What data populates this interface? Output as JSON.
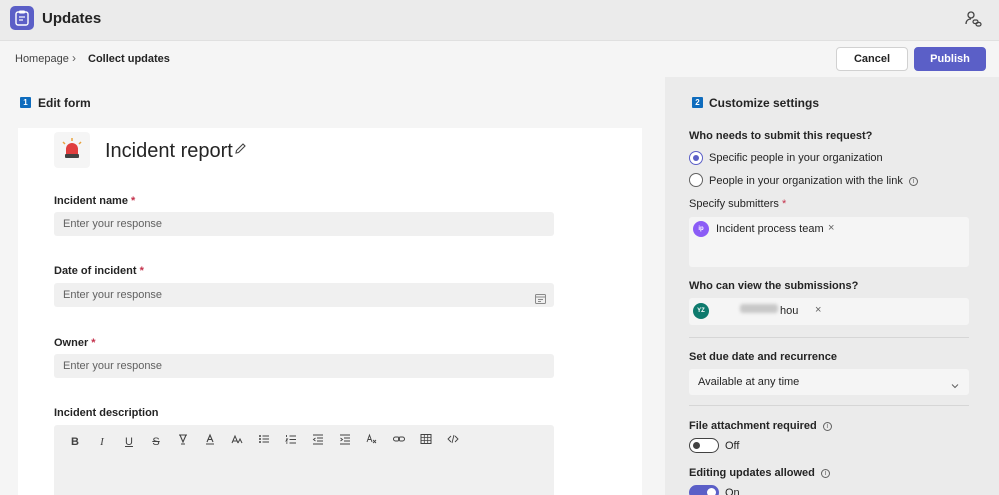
{
  "app": {
    "title": "Updates"
  },
  "breadcrumb": {
    "home": "Homepage",
    "separator": "›",
    "current": "Collect updates"
  },
  "actions": {
    "cancel_label": "Cancel",
    "publish_label": "Publish"
  },
  "edit_form": {
    "step": "1",
    "title": "Edit form",
    "form_title": "Incident report",
    "fields": [
      {
        "label": "Incident name",
        "required_mark": "*",
        "placeholder": "Enter your response"
      },
      {
        "label": "Date of incident",
        "required_mark": "*",
        "placeholder": "Enter your response"
      },
      {
        "label": "Owner",
        "required_mark": "*",
        "placeholder": "Enter your response"
      }
    ],
    "description_label": "Incident description",
    "toolbar": [
      "B",
      "I",
      "U",
      "S"
    ]
  },
  "settings": {
    "step": "2",
    "title": "Customize settings",
    "submit_question": "Who needs to submit this request?",
    "options": [
      {
        "label": "Specific people in your organization",
        "selected": true
      },
      {
        "label": "People in your organization with the link",
        "selected": false
      }
    ],
    "submitters_label": "Specify submitters",
    "submitters_required": "*",
    "submitter_chip": {
      "initials": "ip",
      "name": "Incident process team",
      "remove": "×"
    },
    "view_question": "Who can view the submissions?",
    "viewer_chip": {
      "initials": "YZ",
      "name_visible": "hou",
      "remove": "×"
    },
    "due_date_label": "Set due date and recurrence",
    "due_date_value": "Available at any time",
    "attachment_label": "File attachment required",
    "attachment_state": "Off",
    "editing_label": "Editing updates allowed",
    "editing_state": "On"
  },
  "colors": {
    "brand": "#5b5fc7",
    "step_badge": "#0f6cbd",
    "required": "#c4314b"
  }
}
